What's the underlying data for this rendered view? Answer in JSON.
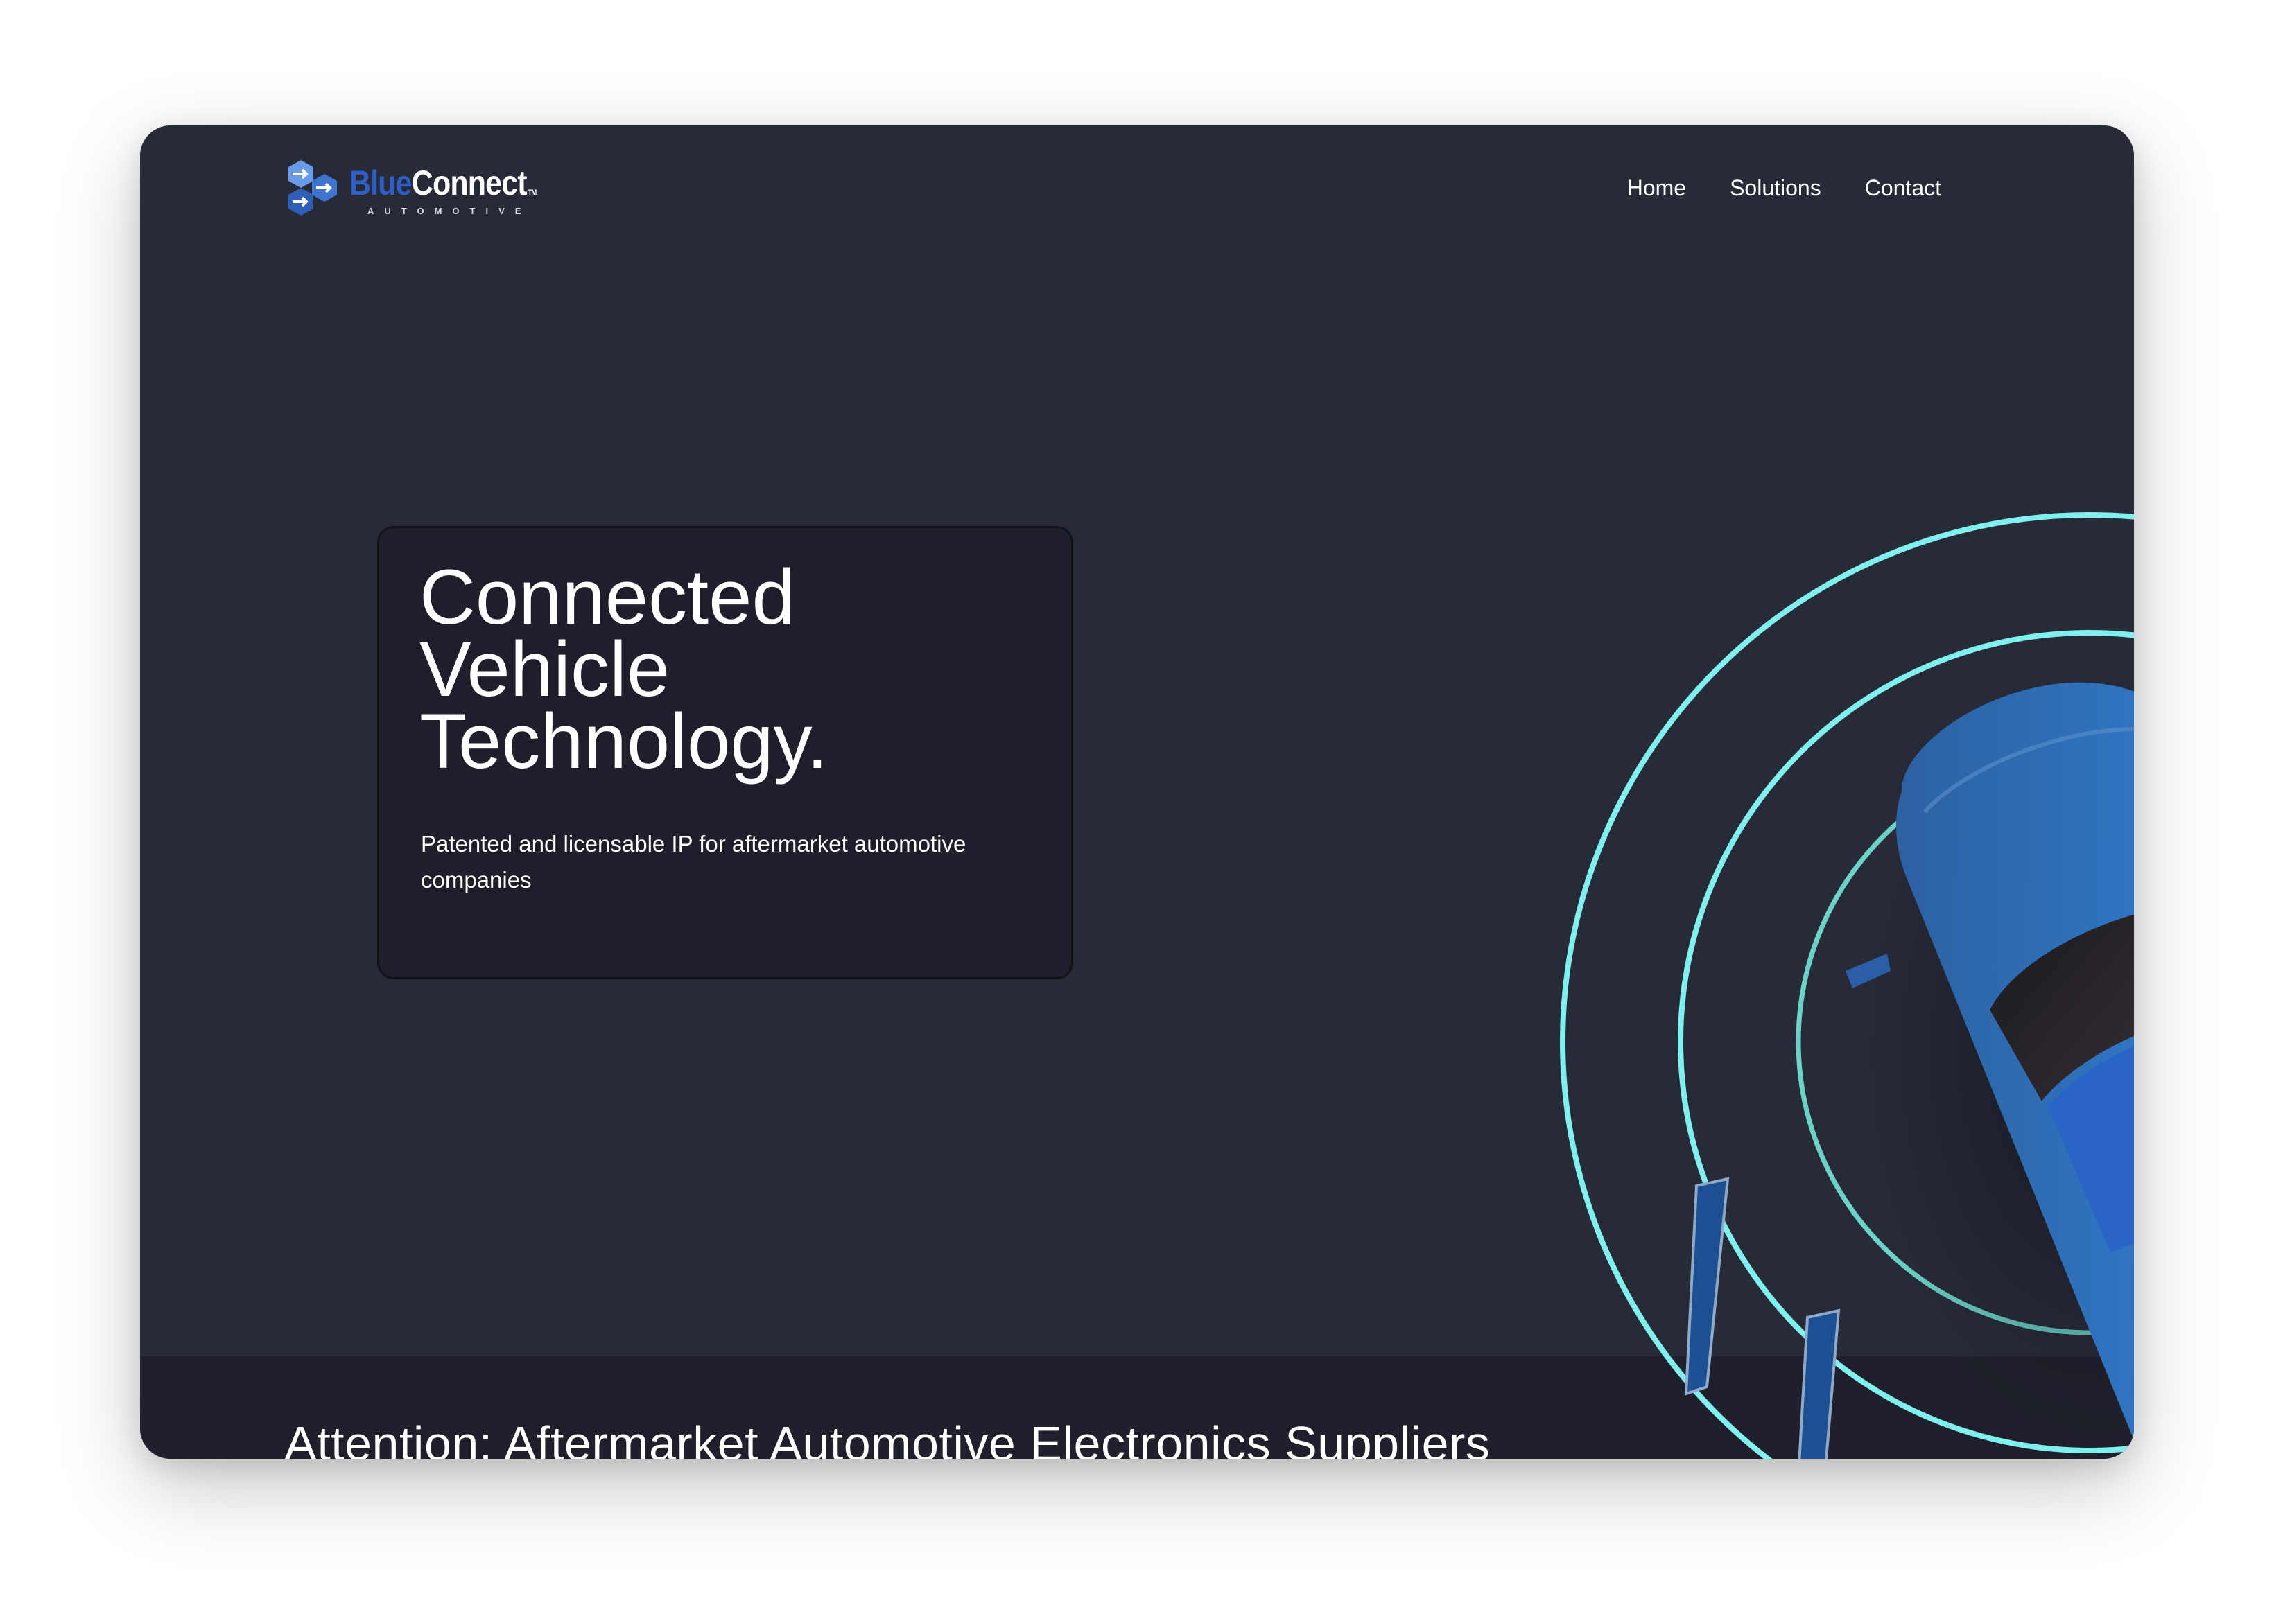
{
  "brand": {
    "name_part1": "Blue",
    "name_part2": "Connect",
    "trademark": "TM",
    "subtitle": "AUTOMOTIVE",
    "logo_icon": "hexagon-arrows-icon",
    "colors": {
      "blue": "#2e5fc8",
      "hex_light": "#6a9be8",
      "hex_dark": "#2f5fb5"
    }
  },
  "nav": {
    "items": [
      {
        "label": "Home"
      },
      {
        "label": "Solutions"
      },
      {
        "label": "Contact"
      }
    ]
  },
  "hero": {
    "title_lines": [
      "Connected",
      "Vehicle",
      "Technology."
    ],
    "subtitle": "Patented and licensable IP for aftermarket automotive companies",
    "ring_color": "#7ff0ee",
    "car_color": "#2f6fb8",
    "illustration": "car-top-view-with-signal-rings"
  },
  "section_two": {
    "heading": "Attention: Aftermarket Automotive Electronics Suppliers"
  },
  "colors": {
    "background": "#272b37",
    "card": "#1f1f2b",
    "section_band": "#1f202b",
    "text": "#ffffff"
  }
}
